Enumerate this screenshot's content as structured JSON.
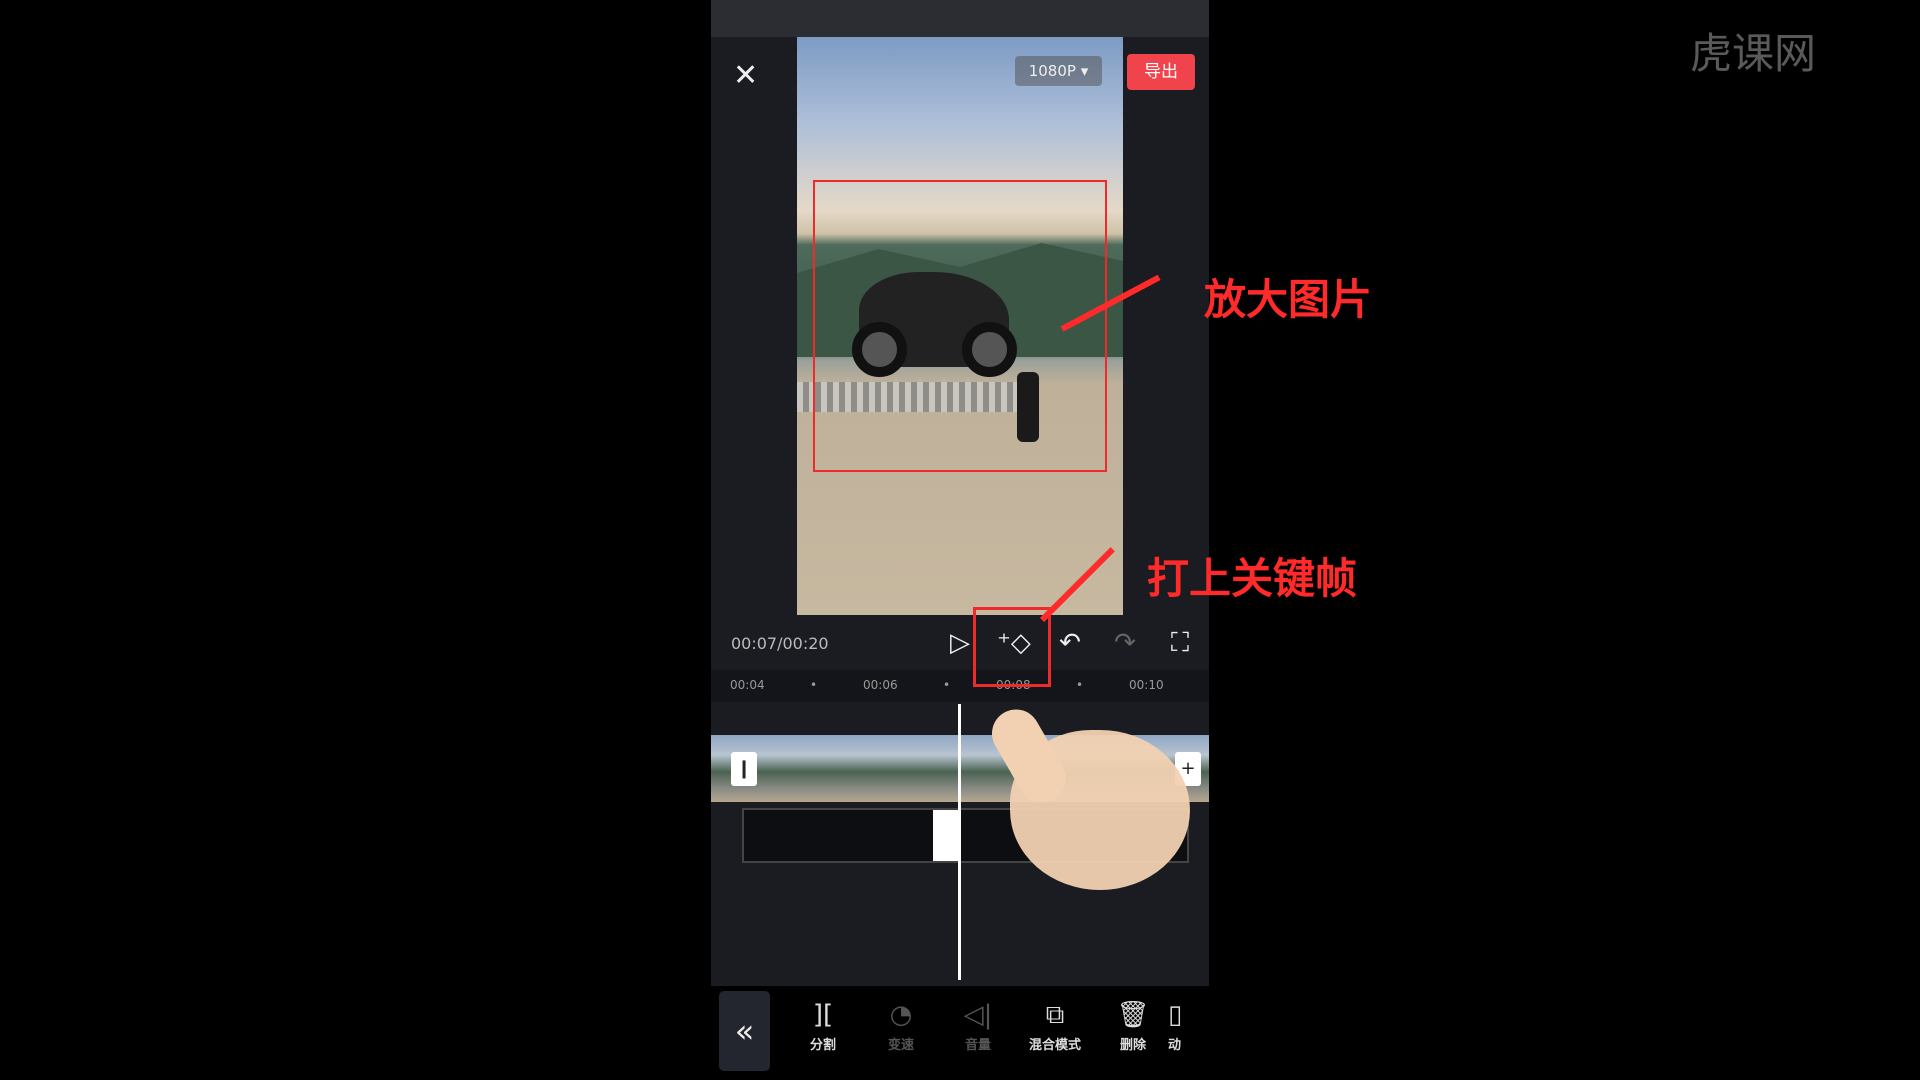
{
  "watermark": "虎课网",
  "header": {
    "resolution": "1080P",
    "export_label": "导出"
  },
  "player": {
    "timecode": "00:07/00:20"
  },
  "ruler": {
    "ticks": [
      "00:04",
      "00:06",
      "00:08",
      "00:10"
    ]
  },
  "toolbar": {
    "items": [
      {
        "label": "分割",
        "icon": "split-icon",
        "enabled": true
      },
      {
        "label": "变速",
        "icon": "speed-icon",
        "enabled": false
      },
      {
        "label": "音量",
        "icon": "volume-icon",
        "enabled": false
      },
      {
        "label": "混合模式",
        "icon": "blend-mode-icon",
        "enabled": true
      },
      {
        "label": "删除",
        "icon": "delete-icon",
        "enabled": true
      },
      {
        "label": "动",
        "icon": "animation-icon",
        "enabled": true
      }
    ]
  },
  "annotations": {
    "zoom_image": "放大图片",
    "add_keyframe": "打上关键帧"
  },
  "colors": {
    "accent": "#f0434b",
    "annotation": "#ff2a2a"
  }
}
